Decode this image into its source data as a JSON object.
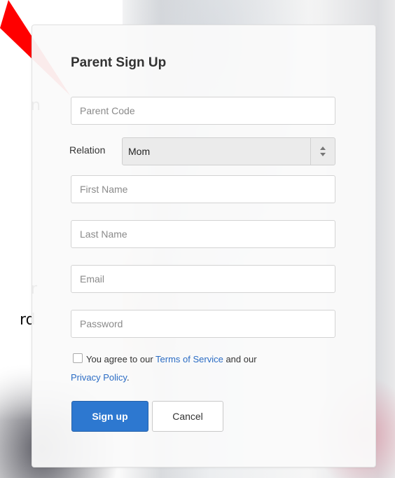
{
  "annotation": {
    "fragment_1": "n",
    "fragment_2": "r",
    "fragment_3": "rd",
    "color": "#ff0000"
  },
  "form": {
    "title": "Parent Sign Up",
    "parent_code": {
      "value": "",
      "placeholder": "Parent Code"
    },
    "relation": {
      "label": "Relation",
      "selected": "Mom"
    },
    "first_name": {
      "value": "",
      "placeholder": "First Name"
    },
    "last_name": {
      "value": "",
      "placeholder": "Last Name"
    },
    "email": {
      "value": "",
      "placeholder": "Email"
    },
    "password": {
      "value": "",
      "placeholder": "Password"
    },
    "agreement": {
      "checked": false,
      "text_before": "You agree to our ",
      "terms_link": "Terms of Service",
      "text_middle": " and our",
      "privacy_link": "Privacy Policy",
      "text_after": "."
    },
    "buttons": {
      "sign_up": "Sign up",
      "cancel": "Cancel"
    }
  },
  "colors": {
    "primary": "#2d78d0",
    "link": "#2b6cc4",
    "annotation_red": "#ff0000"
  }
}
